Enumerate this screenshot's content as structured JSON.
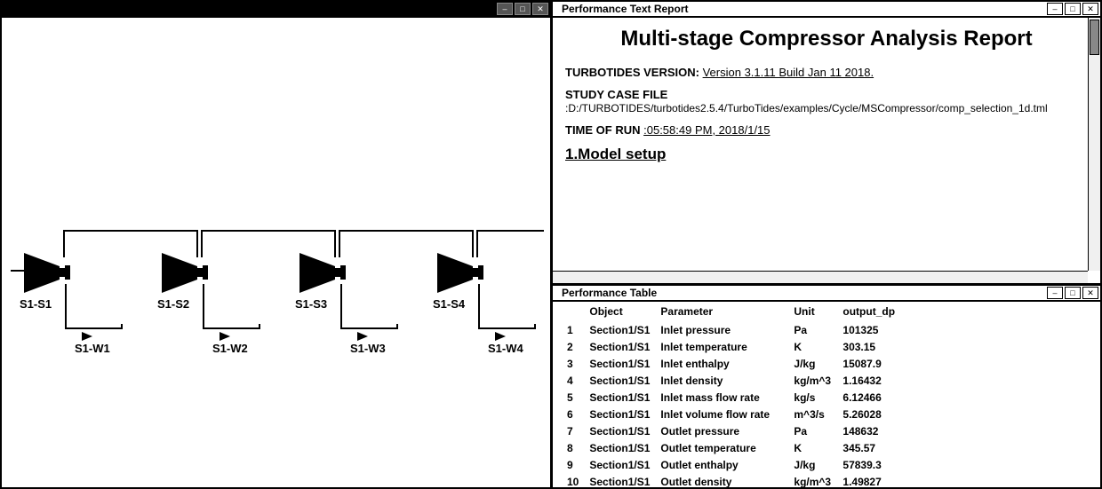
{
  "left_window": {
    "title": ""
  },
  "diagram": {
    "stages": [
      {
        "label": "S1-S1"
      },
      {
        "label": "S1-S2"
      },
      {
        "label": "S1-S3"
      },
      {
        "label": "S1-S4"
      }
    ],
    "flows": [
      {
        "label": "S1-W1"
      },
      {
        "label": "S1-W2"
      },
      {
        "label": "S1-W3"
      },
      {
        "label": "S1-W4"
      }
    ]
  },
  "report_window": {
    "title": "Performance Text Report",
    "main_heading": "Multi-stage Compressor Analysis Report",
    "version_label": "TURBOTIDES VERSION:",
    "version_value": "Version 3.1.11 Build Jan 11 2018.",
    "case_label": "STUDY CASE FILE",
    "case_value": ":D:/TURBOTIDES/turbotides2.5.4/TurboTides/examples/Cycle/MSCompressor/comp_selection_1d.tml",
    "time_label": "TIME OF RUN",
    "time_value": ":05:58:49 PM, 2018/1/15",
    "section_heading": "1.Model setup"
  },
  "table_window": {
    "title": "Performance Table",
    "headers": {
      "object": "Object",
      "parameter": "Parameter",
      "unit": "Unit",
      "output": "output_dp"
    },
    "rows": [
      {
        "idx": "1",
        "object": "Section1/S1",
        "parameter": "Inlet pressure",
        "unit": "Pa",
        "value": "101325"
      },
      {
        "idx": "2",
        "object": "Section1/S1",
        "parameter": "Inlet temperature",
        "unit": "K",
        "value": "303.15"
      },
      {
        "idx": "3",
        "object": "Section1/S1",
        "parameter": "Inlet enthalpy",
        "unit": "J/kg",
        "value": "15087.9"
      },
      {
        "idx": "4",
        "object": "Section1/S1",
        "parameter": "Inlet density",
        "unit": "kg/m^3",
        "value": "1.16432"
      },
      {
        "idx": "5",
        "object": "Section1/S1",
        "parameter": "Inlet mass flow rate",
        "unit": "kg/s",
        "value": "6.12466"
      },
      {
        "idx": "6",
        "object": "Section1/S1",
        "parameter": "Inlet volume flow rate",
        "unit": "m^3/s",
        "value": "5.26028"
      },
      {
        "idx": "7",
        "object": "Section1/S1",
        "parameter": "Outlet pressure",
        "unit": "Pa",
        "value": "148632"
      },
      {
        "idx": "8",
        "object": "Section1/S1",
        "parameter": "Outlet temperature",
        "unit": "K",
        "value": "345.57"
      },
      {
        "idx": "9",
        "object": "Section1/S1",
        "parameter": "Outlet enthalpy",
        "unit": "J/kg",
        "value": "57839.3"
      },
      {
        "idx": "10",
        "object": "Section1/S1",
        "parameter": "Outlet density",
        "unit": "kg/m^3",
        "value": "1.49827"
      }
    ]
  }
}
